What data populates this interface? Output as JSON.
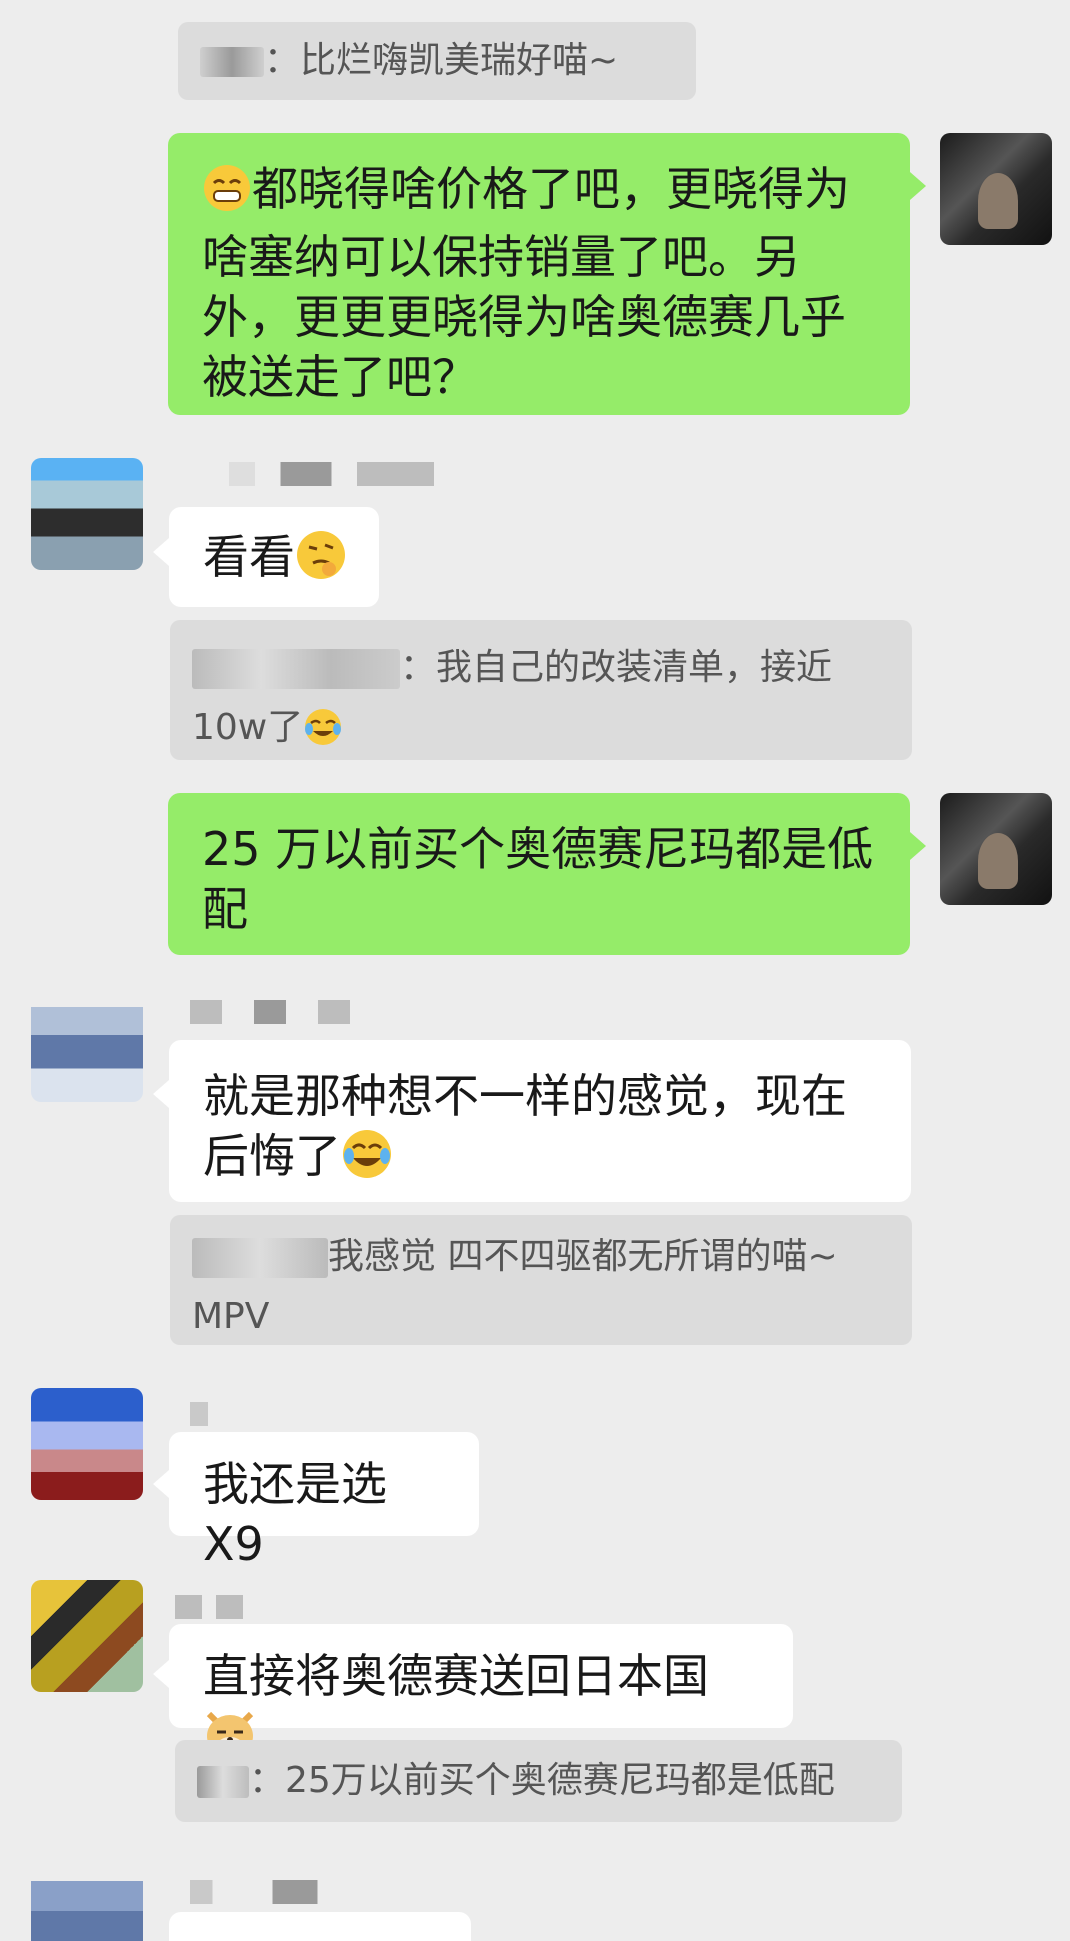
{
  "messages": {
    "m1_quote": "：比烂嗨凯美瑞好喵~",
    "m2_me": "都晓得啥价格了吧，更晓得为啥塞纳可以保持销量了吧。另外，更更更晓得为啥奥德赛几乎被送走了吧？",
    "m3_other": "看看",
    "m3_quote": "：我自己的改装清单，接近10w了",
    "m4_me": "25 万以前买个奥德赛尼玛都是低配",
    "m5_other": "就是那种想不一样的感觉，现在后悔了",
    "m5_quote": "我感觉 四不四驱都无所谓的喵~ MPV",
    "m6_other": "我还是选 X9",
    "m7_other": "直接将奥德赛送回日本国",
    "m7_quote": "：25万以前买个奥德赛尼玛都是低配"
  },
  "emojis": {
    "m2": "grin-emoji",
    "m3": "thinking-emoji",
    "m3_quote": "laugh-cry-emoji",
    "m5": "tears-of-joy-emoji",
    "m7": "doge-emoji"
  },
  "colors": {
    "background": "#ededed",
    "my_bubble": "#95ec69",
    "other_bubble": "#ffffff",
    "quote_bg": "#dcdcdc"
  }
}
